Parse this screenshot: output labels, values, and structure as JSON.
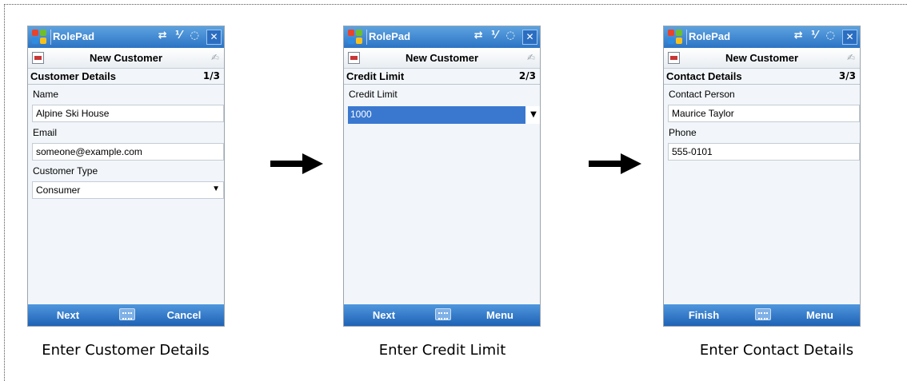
{
  "app_name": "RolePad",
  "status_icons": "⇄ ⅟ ◌",
  "close_glyph": "✕",
  "input_icon_glyph": "✍",
  "form_title": "New Customer",
  "screens": [
    {
      "section_title": "Customer Details",
      "page": "1/3",
      "fields": {
        "name_label": "Name",
        "name_value": "Alpine Ski House",
        "email_label": "Email",
        "email_value": "someone@example.com",
        "type_label": "Customer Type",
        "type_value": "Consumer"
      },
      "left_soft_key": "Next",
      "right_soft_key": "Cancel",
      "caption": "Enter Customer Details"
    },
    {
      "section_title": "Credit Limit",
      "page": "2/3",
      "fields": {
        "credit_label": "Credit Limit",
        "credit_value": "1000"
      },
      "left_soft_key": "Next",
      "right_soft_key": "Menu",
      "caption": "Enter Credit Limit"
    },
    {
      "section_title": "Contact Details",
      "page": "3/3",
      "fields": {
        "contact_label": "Contact Person",
        "contact_value": "Maurice Taylor",
        "phone_label": "Phone",
        "phone_value": "555-0101"
      },
      "left_soft_key": "Finish",
      "right_soft_key": "Menu",
      "caption": "Enter Contact Details"
    }
  ],
  "dropdown_glyph": "▼",
  "colors": {
    "titlebar_blue": "#2c74c4",
    "softkey_blue": "#1f62b6",
    "selection_blue": "#3a78d0"
  }
}
